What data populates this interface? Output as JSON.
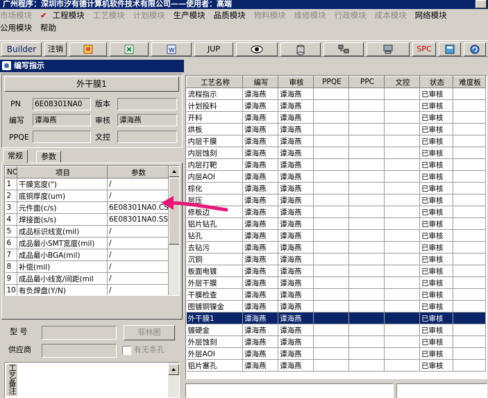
{
  "window": {
    "title": "广州程序：深圳市汐有德计算机软件技术有限公司——使用者：高端"
  },
  "menu": {
    "row1": [
      {
        "label": "市场模块",
        "enabled": false
      },
      {
        "label": "工程模块",
        "enabled": true,
        "checked": true
      },
      {
        "label": "工艺模块",
        "enabled": false
      },
      {
        "label": "计划模块",
        "enabled": false
      },
      {
        "label": "生产模块",
        "enabled": true
      },
      {
        "label": "品质模块",
        "enabled": true
      },
      {
        "label": "物料模块",
        "enabled": false
      },
      {
        "label": "维修模块",
        "enabled": false
      },
      {
        "label": "行政模块",
        "enabled": false
      },
      {
        "label": "成本模块",
        "enabled": false
      },
      {
        "label": "网络模块",
        "enabled": true
      }
    ],
    "row2": [
      {
        "label": "公用模块",
        "enabled": true
      },
      {
        "label": "帮助",
        "enabled": true
      }
    ]
  },
  "toolbar": {
    "builder": "Builder",
    "logout": "注销",
    "jup": "JUP",
    "spc": "SPC",
    "icons": [
      "ppt-icon",
      "excel-icon",
      "word-icon",
      "eye-icon",
      "database-icon",
      "network-icon",
      "computer-icon",
      "calculator-icon",
      "refresh-icon"
    ]
  },
  "subwindow": {
    "title": "编写指示"
  },
  "form": {
    "process_name": "外干膜1",
    "pn_label": "PN",
    "pn_value": "6E08301NA0",
    "version_label": "版本",
    "version_value": "",
    "writer_label": "编写",
    "writer_value": "谭海燕",
    "reviewer_label": "审核",
    "reviewer_value": "谭海燕",
    "ppqe_label": "PPQE",
    "ppqe_value": "",
    "doc_control_label": "文控",
    "doc_control_value": ""
  },
  "tabs": {
    "general": "常规",
    "params": "参数"
  },
  "params_grid": {
    "headers": {
      "no": "NO",
      "item": "项目",
      "param": "参数"
    },
    "rows": [
      {
        "no": "1",
        "item": "干膜宽度(\")",
        "param": "/"
      },
      {
        "no": "2",
        "item": "底铜厚度(um)",
        "param": "/"
      },
      {
        "no": "3",
        "item": "元件面(c/s)",
        "param": "6E08301NA0.CS"
      },
      {
        "no": "4",
        "item": "焊接面(s/s)",
        "param": "6E08301NA0.SS"
      },
      {
        "no": "5",
        "item": "成品标识线宽(mil)",
        "param": "/"
      },
      {
        "no": "6",
        "item": "成品最小SMT宽度(mil)",
        "param": "/"
      },
      {
        "no": "7",
        "item": "成品最小BGA(mil)",
        "param": "/"
      },
      {
        "no": "8",
        "item": "补偿(mil)",
        "param": "/"
      },
      {
        "no": "9",
        "item": "成品最小线宽/间距(mil",
        "param": "/"
      },
      {
        "no": "10",
        "item": "有负焊盘(Y/N)",
        "param": "/"
      }
    ]
  },
  "bottom_form": {
    "model_label": "型  号",
    "model_value": "",
    "supplier_label": "供应商",
    "supplier_value": "",
    "film_button": "菲林图",
    "barcode_label": "有无条孔",
    "vertical_label": "工艺备注"
  },
  "process_table": {
    "headers": [
      "工艺名称",
      "编写",
      "审核",
      "PPQE",
      "PPC",
      "文控",
      "状态",
      "难度板"
    ],
    "selected_index": 20,
    "rows": [
      {
        "name": "流程指示",
        "writer": "谭海燕",
        "reviewer": "谭海燕",
        "status": "已审核"
      },
      {
        "name": "计划投料",
        "writer": "谭海燕",
        "reviewer": "谭海燕",
        "status": "已审核"
      },
      {
        "name": "开料",
        "writer": "谭海燕",
        "reviewer": "谭海燕",
        "status": "已审核"
      },
      {
        "name": "烘板",
        "writer": "谭海燕",
        "reviewer": "谭海燕",
        "status": "已审核"
      },
      {
        "name": "内层干膜",
        "writer": "谭海燕",
        "reviewer": "谭海燕",
        "status": "已审核"
      },
      {
        "name": "内层蚀刻",
        "writer": "谭海燕",
        "reviewer": "谭海燕",
        "status": "已审核"
      },
      {
        "name": "内层打靶",
        "writer": "谭海燕",
        "reviewer": "谭海燕",
        "status": "已审核"
      },
      {
        "name": "内层AOI",
        "writer": "谭海燕",
        "reviewer": "谭海燕",
        "status": "已审核"
      },
      {
        "name": "棕化",
        "writer": "谭海燕",
        "reviewer": "谭海燕",
        "status": "已审核"
      },
      {
        "name": "层压",
        "writer": "谭海燕",
        "reviewer": "谭海燕",
        "status": "已审核"
      },
      {
        "name": "修板边",
        "writer": "谭海燕",
        "reviewer": "谭海燕",
        "status": "已审核"
      },
      {
        "name": "铝片钻孔",
        "writer": "谭海燕",
        "reviewer": "谭海燕",
        "status": "已审核"
      },
      {
        "name": "钻孔",
        "writer": "谭海燕",
        "reviewer": "谭海燕",
        "status": "已审核"
      },
      {
        "name": "去钻污",
        "writer": "谭海燕",
        "reviewer": "谭海燕",
        "status": "已审核"
      },
      {
        "name": "沉铜",
        "writer": "谭海燕",
        "reviewer": "谭海燕",
        "status": "已审核"
      },
      {
        "name": "板面电镀",
        "writer": "谭海燕",
        "reviewer": "谭海燕",
        "status": "已审核"
      },
      {
        "name": "外层干膜",
        "writer": "谭海燕",
        "reviewer": "谭海燕",
        "status": "已审核"
      },
      {
        "name": "干膜检查",
        "writer": "谭海燕",
        "reviewer": "谭海燕",
        "status": "已审核"
      },
      {
        "name": "图镀铜镍金",
        "writer": "谭海燕",
        "reviewer": "谭海燕",
        "status": "已审核"
      },
      {
        "name": "外干膜1",
        "writer": "谭海燕",
        "reviewer": "谭海燕",
        "status": "已审核"
      },
      {
        "name": "镀硬金",
        "writer": "谭海燕",
        "reviewer": "谭海燕",
        "status": "已审核"
      },
      {
        "name": "外层蚀刻",
        "writer": "谭海燕",
        "reviewer": "谭海燕",
        "status": "已审核"
      },
      {
        "name": "外层AOI",
        "writer": "谭海燕",
        "reviewer": "谭海燕",
        "status": "已审核"
      },
      {
        "name": "铝片塞孔",
        "writer": "谭海燕",
        "reviewer": "谭海燕",
        "status": "已审核"
      }
    ]
  },
  "colors": {
    "selection": "#0a246a",
    "annotation_arrow": "#e8187a",
    "titlebar": "#0a246a"
  }
}
